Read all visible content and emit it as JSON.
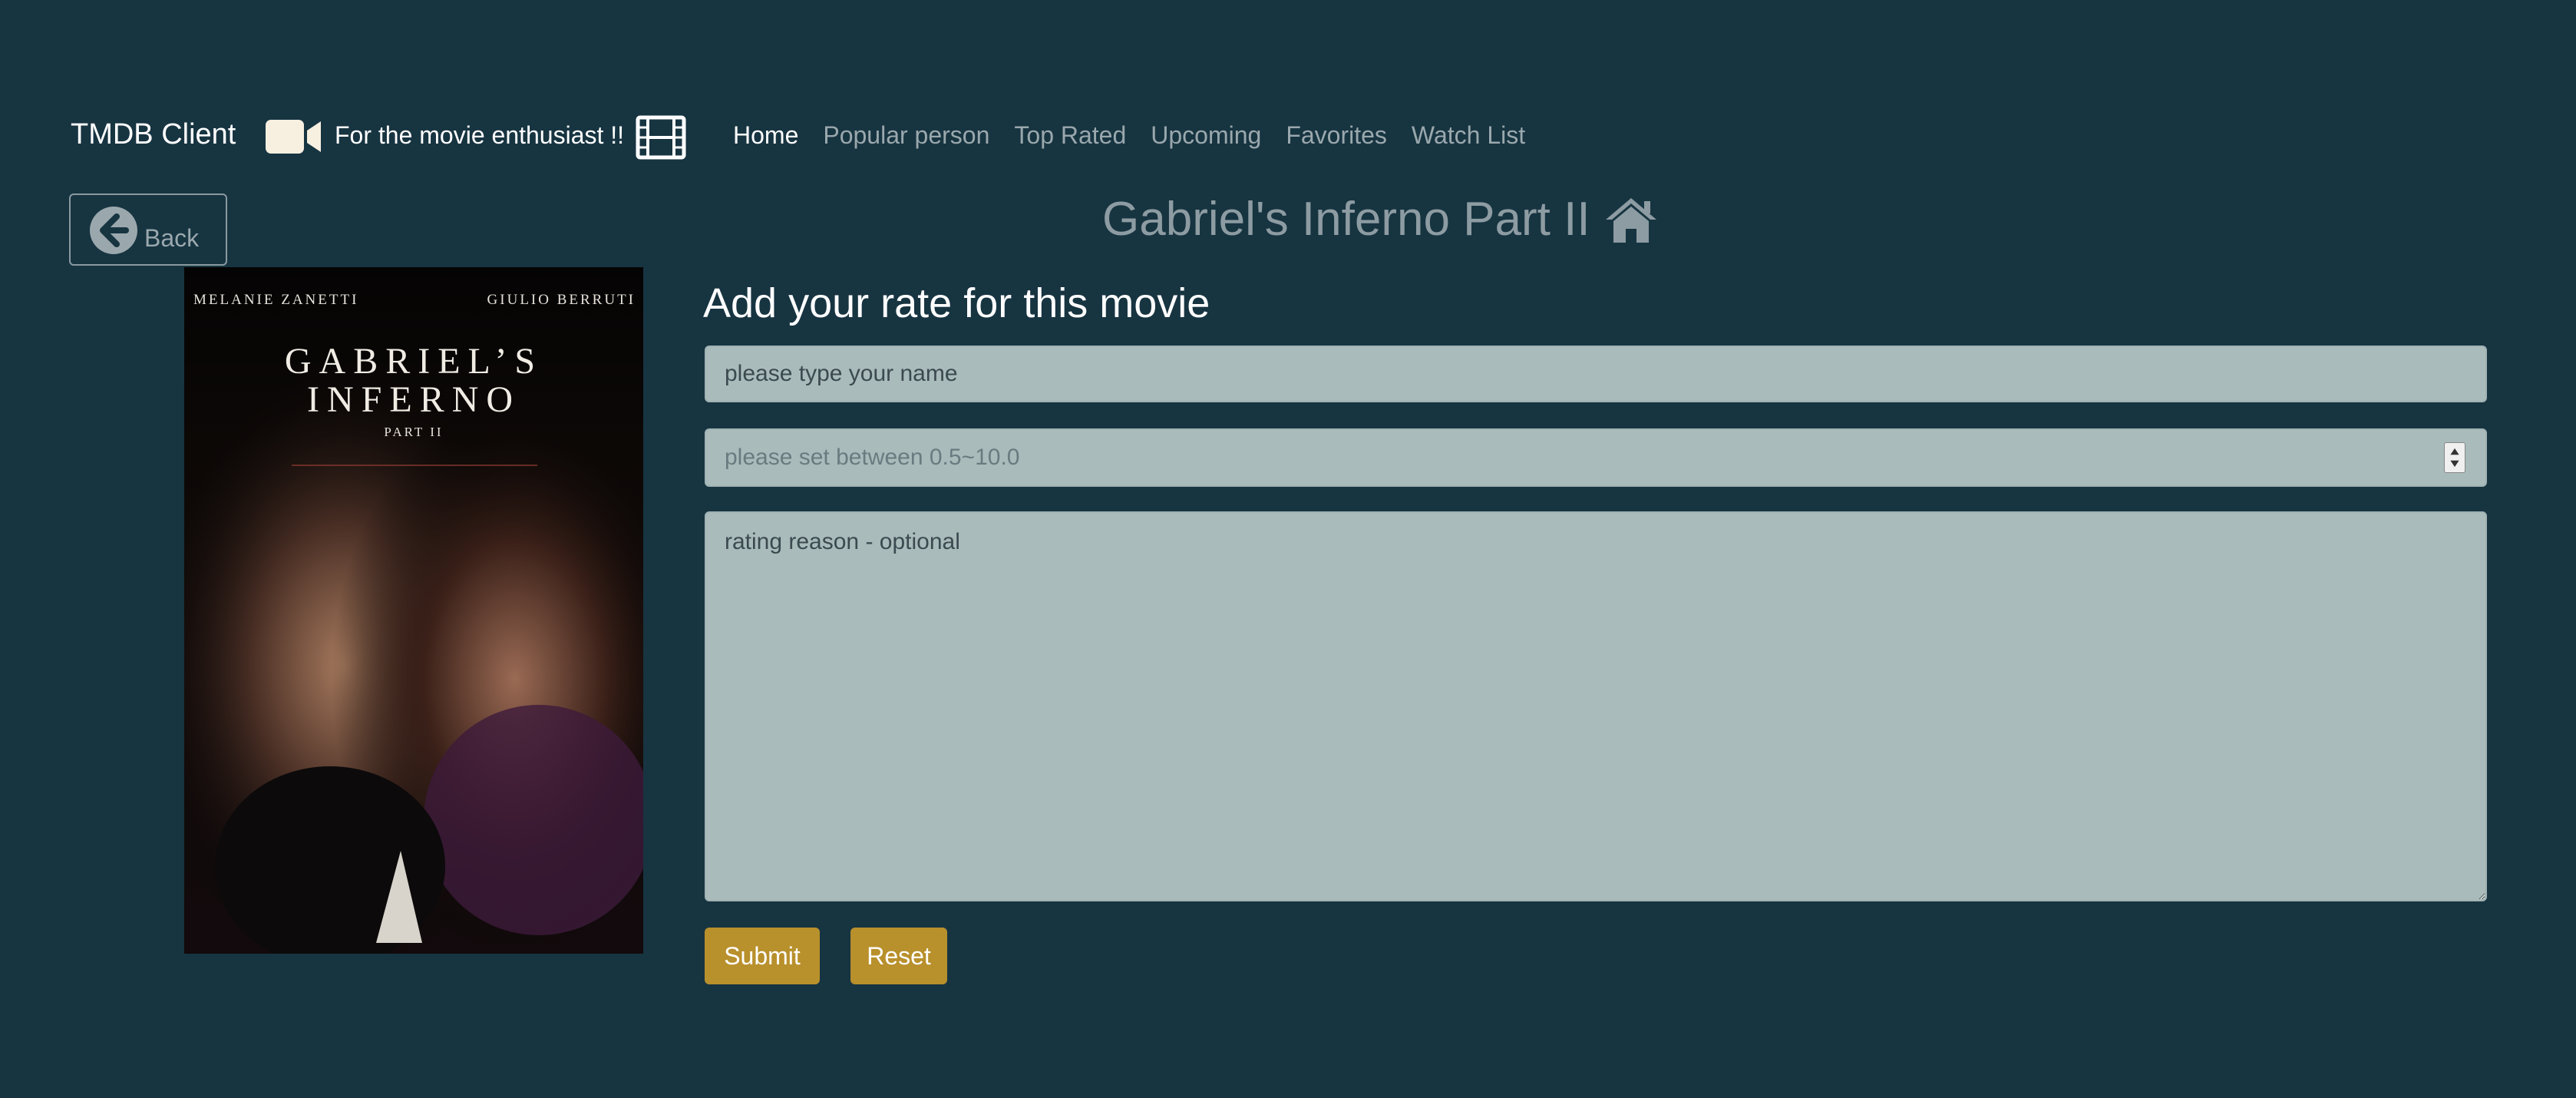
{
  "navbar": {
    "brand": "TMDB Client",
    "tagline": "For the movie enthusiast !!",
    "links": [
      {
        "label": "Home",
        "active": true
      },
      {
        "label": "Popular person"
      },
      {
        "label": "Top Rated"
      },
      {
        "label": "Upcoming"
      },
      {
        "label": "Favorites"
      },
      {
        "label": "Watch List"
      }
    ],
    "icons": {
      "camera": "video-camera-icon",
      "film": "film-icon"
    }
  },
  "back_button": {
    "label": "Back",
    "icon": "arrow-circle-left-icon"
  },
  "movie": {
    "title": "Gabriel's Inferno Part II",
    "title_icon": "home-icon",
    "poster": {
      "credit_left": "MELANIE ZANETTI",
      "credit_right": "GIULIO BERRUTI",
      "title_line1": "GABRIEL’S",
      "title_line2": "INFERNO",
      "subtitle": "PART II"
    }
  },
  "form": {
    "heading": "Add your rate for this movie",
    "name_placeholder": "please type your name",
    "rate_placeholder": "please set between 0.5~10.0",
    "reason_placeholder": "rating reason - optional",
    "submit_label": "Submit",
    "reset_label": "Reset"
  },
  "colors": {
    "background": "#173441",
    "field_bg": "#a9bbbb",
    "button": "#b8902c",
    "muted_text": "#8d9ca2"
  }
}
